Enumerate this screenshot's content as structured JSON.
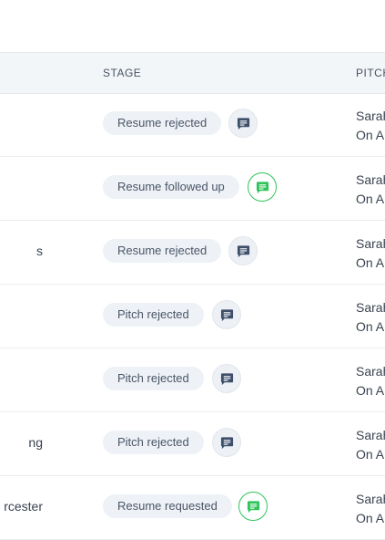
{
  "header": {
    "stage": "STAGE",
    "pitch": "PITCH"
  },
  "rows": [
    {
      "left": "",
      "stage": "Resume rejected",
      "chat": "grey",
      "pitch_line1": "Sarah",
      "pitch_line2": "On Ap"
    },
    {
      "left": "",
      "stage": "Resume followed up",
      "chat": "green",
      "pitch_line1": "Sarah",
      "pitch_line2": "On Ap"
    },
    {
      "left": "s",
      "stage": "Resume rejected",
      "chat": "grey",
      "pitch_line1": "Sarah",
      "pitch_line2": "On Ap"
    },
    {
      "left": "",
      "stage": "Pitch rejected",
      "chat": "grey",
      "pitch_line1": "Sarah",
      "pitch_line2": "On Ap"
    },
    {
      "left": "",
      "stage": "Pitch rejected",
      "chat": "grey",
      "pitch_line1": "Sarah",
      "pitch_line2": "On Ap"
    },
    {
      "left": "ng",
      "stage": "Pitch rejected",
      "chat": "grey",
      "pitch_line1": "Sarah",
      "pitch_line2": "On Ap"
    },
    {
      "left": "rcester",
      "stage": "Resume requested",
      "chat": "green",
      "pitch_line1": "Sarah",
      "pitch_line2": "On Ap"
    }
  ],
  "icons": {
    "chat": "chat-bubble-icon"
  },
  "colors": {
    "grey_icon": "#3d4f6b",
    "green_icon": "#2fc45a",
    "header_bg": "#f3f6f9"
  }
}
